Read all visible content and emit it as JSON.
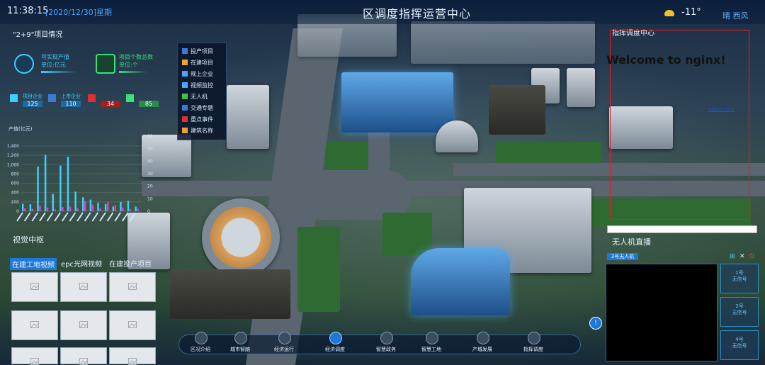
{
  "header": {
    "time": "11:38:15",
    "date": "[2020/12/30]星期",
    "title": "区调度指挥运营中心",
    "temperature": "-11°",
    "weather": "晴 西风"
  },
  "left_panel": {
    "title": "\"2+9\"项目情况",
    "stats": [
      {
        "label": "可实现产值",
        "sub": "单位:亿元"
      },
      {
        "label": "项目个数总数",
        "sub": "单位:个"
      }
    ],
    "mini": [
      {
        "label": "项目企业",
        "value": "125"
      },
      {
        "label": "上市企业",
        "value": "110"
      },
      {
        "label": "",
        "value": "34"
      },
      {
        "label": "",
        "value": "85"
      }
    ]
  },
  "chart_data": {
    "type": "bar",
    "ylabel": "产值(亿元)",
    "ylim": [
      0,
      1400
    ],
    "yticks": [
      "1,400",
      "1,200",
      "1,000",
      "800",
      "600",
      "400",
      "200",
      "0"
    ],
    "y2ticks": [
      "60",
      "50",
      "40",
      "30",
      "20",
      "10",
      "0"
    ],
    "series": [
      {
        "values": [
          160,
          150,
          960,
          1210,
          370,
          980,
          1170,
          420,
          300,
          250,
          180,
          150,
          100,
          200,
          220,
          100
        ],
        "color": "#3cd0ff"
      },
      {
        "values": [
          60,
          50,
          120,
          80,
          40,
          90,
          100,
          60,
          220,
          140,
          60,
          200,
          130,
          80,
          40,
          50
        ],
        "color": "#e040c0"
      }
    ]
  },
  "legend": {
    "items": [
      {
        "label": "投产项目",
        "color": "#3a7bd5"
      },
      {
        "label": "在建项目",
        "color": "#f0a030"
      },
      {
        "label": "规上企业",
        "color": "#4fa3ff"
      },
      {
        "label": "视频监控",
        "color": "#4fa3ff"
      },
      {
        "label": "无人机",
        "color": "#40c040"
      },
      {
        "label": "交通专题",
        "color": "#3a7bd5"
      },
      {
        "label": "重点事件",
        "color": "#e03030"
      },
      {
        "label": "建筑名称",
        "color": "#f0a030"
      }
    ]
  },
  "video": {
    "title": "视觉中枢",
    "tabs": [
      "在建工地视频",
      "epc光网视频",
      "在建投产项目"
    ]
  },
  "right_panel": {
    "title": "指挥调度中心",
    "nginx_heading": "Welcome to nginx!",
    "nginx_link": "nginx.com"
  },
  "drone": {
    "title": "无人机直播",
    "active_tab": "3号无人机",
    "slots": [
      {
        "name": "1号",
        "status": "无信号"
      },
      {
        "name": "2号",
        "status": "无信号"
      },
      {
        "name": "4号",
        "status": "无信号"
      }
    ]
  },
  "bottom_nav": [
    "区况介绍",
    "城市智脑",
    "经济运行",
    "经济调度",
    "智慧政务",
    "智慧工地",
    "产城发展",
    "指挥调度"
  ]
}
